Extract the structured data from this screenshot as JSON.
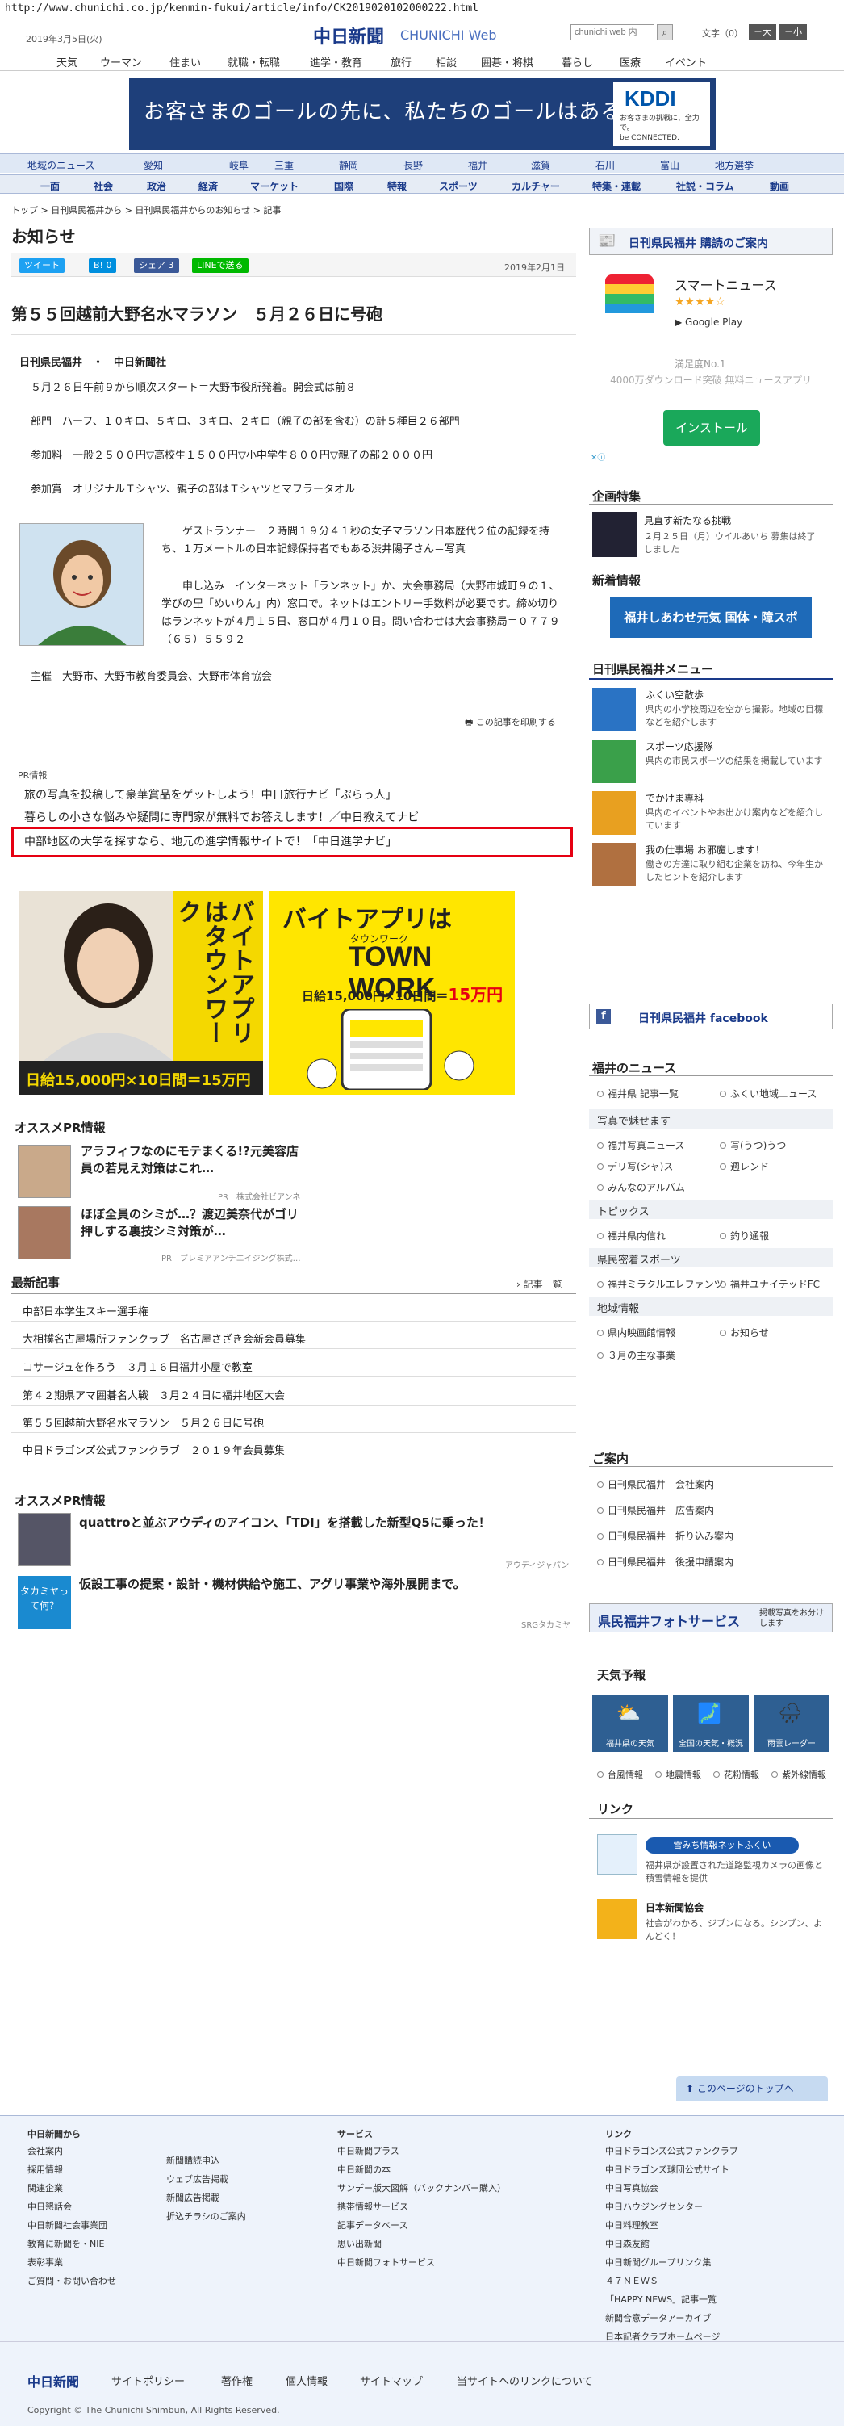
{
  "url": "http://www.chunichi.co.jp/kenmin-fukui/article/info/CK2019020102000222.html",
  "header": {
    "date": "2019年3月5日(火)",
    "logo": "中日新聞",
    "logo_en": "CHUNICHI Web",
    "search_placeholder": "chunichi web 内",
    "font_size_label": "文字（0）",
    "font_plus": "＋大",
    "font_minus": "－小"
  },
  "global_nav": [
    "天気",
    "ウーマン",
    "住まい",
    "就職・転職",
    "進学・教育",
    "旅行",
    "相談",
    "囲碁・将棋",
    "暮らし",
    "医療",
    "イベント"
  ],
  "banner": {
    "text": "お客さまのゴールの先に、私たちのゴールはある。",
    "brand": "KDDI",
    "sub": "お客さまの挑戦に、全力で。",
    "sub2": "be CONNECTED."
  },
  "region_nav": [
    "地域のニュース",
    "愛知",
    "岐阜",
    "三重",
    "静岡",
    "長野",
    "福井",
    "滋賀",
    "石川",
    "富山",
    "地方選挙"
  ],
  "cat_nav": [
    "一面",
    "社会",
    "政治",
    "経済",
    "マーケット",
    "国際",
    "特報",
    "スポーツ",
    "カルチャー",
    "特集・連載",
    "社説・コラム",
    "動画"
  ],
  "breadcrumb": "トップ > 日刊県民福井から > 日刊県民福井からのお知らせ > 記事",
  "page_title": "お知らせ",
  "share": {
    "tweet": "ツイート",
    "hatena": "B! 0",
    "fb": "シェア 3",
    "line": "LINEで送る"
  },
  "article": {
    "date": "2019年2月1日",
    "title": "第５５回越前大野名水マラソン　５月２６日に号砲",
    "byline": "日刊県民福井　・　中日新聞社",
    "p1": "５月２６日午前９から順次スタート＝大野市役所発着。開会式は前８",
    "p2": "部門　ハーフ、１０キロ、５キロ、３キロ、２キロ（親子の部を含む）の計５種目２６部門",
    "p3": "参加料　一般２５００円▽高校生１５００円▽小中学生８００円▽親子の部２０００円",
    "p4": "参加賞　オリジナルＴシャツ、親子の部はＴシャツとマフラータオル",
    "p5": "ゲストランナー　２時間１９分４１秒の女子マラソン日本歴代２位の記録を持ち、１万メートルの日本記録保持者でもある渋井陽子さん＝写真",
    "p6": "申し込み　インターネット「ランネット」か、大会事務局（大野市城町９の１、学びの里「めいりん」内）窓口で。ネットはエントリー手数料が必要です。締め切りはランネットが４月１５日、窓口が４月１０日。問い合わせは大会事務局＝０７７９（６５）５５９２",
    "p7": "主催　大野市、大野市教育委員会、大野市体育協会",
    "print": "この記事を印刷する"
  },
  "pr": {
    "label": "PR情報",
    "items": [
      "旅の写真を投稿して豪華賞品をゲットしよう！中日旅行ナビ「ぷらっ人」",
      "暮らしの小さな悩みや疑問に専門家が無料でお答えします！／中日教えてナビ",
      "中部地区の大学を探すなら、地元の進学情報サイトで！「中日進学ナビ」"
    ]
  },
  "ad_townwork": {
    "vert": "バイトアプリはタウンワーク",
    "wage": "日給15,000円×10日間＝15万円",
    "title": "バイトアプリは",
    "brand": "TOWN WORK",
    "brand_kana": "タウンワーク",
    "wage2": "日給15,000円×10日間＝",
    "wage2b": "15万円"
  },
  "osusume1": {
    "heading": "オススメPR情報",
    "items": [
      {
        "title": "アラフィフなのにモテまくる!?元美容店員の若見え対策はこれ…",
        "src": "PR　株式会社ビアンネ"
      },
      {
        "title": "ほぼ全員のシミが…？渡辺美奈代がゴリ押しする裏技シミ対策が…",
        "src": "PR　プレミアアンチエイジング株式…"
      }
    ]
  },
  "latest": {
    "heading": "最新記事",
    "more": "記事一覧",
    "items": [
      "中部日本学生スキー選手権",
      "大相撲名古屋場所ファンクラブ　名古屋さざき会新会員募集",
      "コサージュを作ろう　３月１６日福井小屋で教室",
      "第４２期県アマ囲碁名人戦　３月２４日に福井地区大会",
      "第５５回越前大野名水マラソン　５月２６日に号砲",
      "中日ドラゴンズ公式ファンクラブ　２０１９年会員募集"
    ]
  },
  "osusume2": {
    "heading": "オススメPR情報",
    "items": [
      {
        "title": "quattroと並ぶアウディのアイコン、「TDI」を搭載した新型Q5に乗った！",
        "src": "アウディジャパン"
      },
      {
        "title": "仮設工事の提案・設計・機材供給や施工、アグリ事業や海外展開まで。",
        "src": "SRGタカミヤ",
        "thumb": "タカミヤって何？"
      }
    ]
  },
  "right": {
    "subscribe": "日刊県民福井 購読のご案内",
    "smartnews": {
      "name": "スマートニュース",
      "stars": "★★★★☆",
      "store": "Google Play",
      "rank": "満足度No.1",
      "desc": "4000万ダウンロード突破 無料ニュースアプリ",
      "btn": "インストール"
    },
    "kikaku": {
      "heading": "企画特集",
      "title": "見直す新たなる挑戦",
      "desc": "２月２５日（月）ウイルあいち 募集は終了しました"
    },
    "shinchaku": {
      "heading": "新着情報",
      "banner": "福井しあわせ元気 国体・障スポ 2018"
    },
    "menu": {
      "heading": "日刊県民福井メニュー",
      "items": [
        {
          "t": "ふくい空散歩",
          "d": "県内の小学校周辺を空から撮影。地域の目標などを紹介します"
        },
        {
          "t": "スポーツ応援隊",
          "d": "県内の市民スポーツの結果を掲載しています"
        },
        {
          "t": "でかけま専科",
          "d": "県内のイベントやお出かけ案内などを紹介しています"
        },
        {
          "t": "我の仕事場 お邪魔します！",
          "d": "働きの方達に取り組む企業を訪ね、今年生かしたヒントを紹介します"
        }
      ]
    },
    "facebook": "日刊県民福井 facebook",
    "news": {
      "heading": "福井のニュース",
      "links": [
        "福井県 記事一覧",
        "ふくい地域ニュース"
      ],
      "photo_h": "写真で魅せます",
      "photo": [
        "福井写真ニュース",
        "写(うつ)うつ",
        "デリ写(シャ)ス",
        "週レンド",
        "みんなのアルバム"
      ],
      "topics_h": "トピックス",
      "topics": [
        "福井県内信れ",
        "釣り通報"
      ],
      "sports_h": "県民密着スポーツ",
      "sports": [
        "福井ミラクルエレファンツ",
        "福井ユナイテッドFC"
      ],
      "area_h": "地域情報",
      "area": [
        "県内映画館情報",
        "お知らせ",
        "３月の主な事業"
      ]
    },
    "guide": {
      "heading": "ご案内",
      "items": [
        "日刊県民福井　会社案内",
        "日刊県民福井　広告案内",
        "日刊県民福井　折り込み案内",
        "日刊県民福井　後援申請案内"
      ]
    },
    "photoservice": "県民福井フォトサービス",
    "photoservice_sub": "掲載写真をお分けします",
    "weather": {
      "heading": "天気予報",
      "tiles": [
        "福井県の天気",
        "全国の天気・概況",
        "雨雲レーダー"
      ],
      "links": [
        "台風情報",
        "地震情報",
        "花粉情報",
        "紫外線情報"
      ]
    },
    "link": {
      "heading": "リンク",
      "items": [
        {
          "t": "雪みち情報ネットふくい",
          "d": "福井県が設置された道路監視カメラの画像と積雪情報を提供"
        },
        {
          "t": "日本新聞協会",
          "d": "社会がわかる、ジブンになる。シンブン、よんどく！"
        }
      ]
    }
  },
  "to_top": "このページのトップへ",
  "footer": {
    "c1h": "中日新聞から",
    "c1": [
      "会社案内",
      "採用情報",
      "関連企業",
      "中日懇話会",
      "中日新聞社会事業団",
      "教育に新聞を・NIE",
      "表彰事業",
      "ご質問・お問い合わせ"
    ],
    "c2": [
      "新聞購読申込",
      "ウェブ広告掲載",
      "新聞広告掲載",
      "折込チラシのご案内"
    ],
    "c3h": "サービス",
    "c3": [
      "中日新聞プラス",
      "中日新聞の本",
      "サンデー版大図解（バックナンバー購入）",
      "携帯情報サービス",
      "記事データベース",
      "思い出新聞",
      "中日新聞フォトサービス"
    ],
    "c4h": "リンク",
    "c4": [
      "中日ドラゴンズ公式ファンクラブ",
      "中日ドラゴンズ球団公式サイト",
      "中日写真協会",
      "中日ハウジングセンター",
      "中日料理教室",
      "中日森友館",
      "中日新聞グループリンク集",
      "４７ＮＥＷＳ",
      "「HAPPY NEWS」記事一覧",
      "新聞合意データアーカイブ",
      "日本記者クラブホームページ"
    ],
    "bottom_logo": "中日新聞",
    "bottom": [
      "サイトポリシー",
      "著作権",
      "個人情報",
      "サイトマップ",
      "当サイトへのリンクについて"
    ],
    "copyright": "Copyright © The Chunichi Shimbun, All Rights Reserved."
  },
  "colors": {
    "accent": "#1a3a8a",
    "red": "#e60012",
    "nav_bg": "#dfe8f5",
    "footer_bg": "#eef3fb"
  }
}
